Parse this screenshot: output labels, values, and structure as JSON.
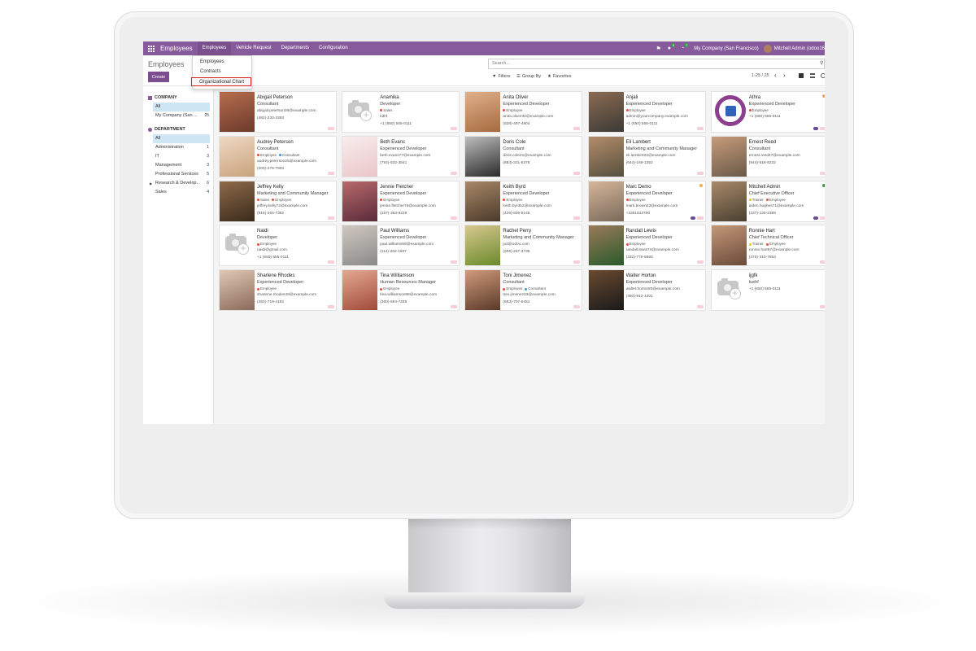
{
  "app": {
    "brand": "Employees",
    "menus": [
      "Employees",
      "Vehicle Request",
      "Departments",
      "Configuration"
    ],
    "company": "My Company (San Francisco)",
    "user": "Mitchell Admin (odoo16",
    "badges": {
      "messages": "5",
      "activities": "7"
    }
  },
  "dropdown": {
    "items": [
      "Employees",
      "Contracts",
      "Organizational Chart"
    ]
  },
  "control": {
    "breadcrumb": "Employees",
    "create": "Create",
    "search_placeholder": "Search...",
    "filters": "Filters",
    "group_by": "Group By",
    "favorites": "Favorites",
    "pager": "1-25 / 25"
  },
  "sidepanel": {
    "company_title": "COMPANY",
    "companies": [
      {
        "label": "All",
        "count": ""
      },
      {
        "label": "My Company (San ...",
        "count": "25"
      }
    ],
    "department_title": "DEPARTMENT",
    "departments": [
      {
        "label": "All",
        "count": ""
      },
      {
        "label": "Administration",
        "count": "1"
      },
      {
        "label": "IT",
        "count": "3"
      },
      {
        "label": "Management",
        "count": "3"
      },
      {
        "label": "Professional Services",
        "count": "5"
      },
      {
        "label": "Research & Develop...",
        "count": "6"
      },
      {
        "label": "Sales",
        "count": "4"
      }
    ]
  },
  "colors": {
    "primary": "#875a9b",
    "employee_tag": "#e74c3c",
    "consultant_tag": "#3498db",
    "trainer_tag": "#f1c40f"
  },
  "employees": [
    {
      "name": "Abigail Peterson",
      "job": "Consultant",
      "tags": [],
      "email": "abigail.peterson39@example.com",
      "phone": "(482)-233-3393",
      "photo": [
        "#6b3a2a",
        "#b66e4e"
      ]
    },
    {
      "name": "Anamika",
      "job": "Developer",
      "tags": [
        {
          "label": "Sales",
          "color": "#e74c3c"
        }
      ],
      "email": "kdhf",
      "phone": "+1 (650) 555-0111",
      "photo": "placeholder"
    },
    {
      "name": "Anita Oliver",
      "job": "Experienced Developer",
      "tags": [
        {
          "label": "Employee",
          "color": "#e74c3c"
        }
      ],
      "email": "anita.oliver32@example.com",
      "phone": "(538)-497-4804",
      "photo": [
        "#a56b3f",
        "#e0b08c"
      ]
    },
    {
      "name": "Anjali",
      "job": "Experienced Developer",
      "tags": [
        {
          "label": "Employee",
          "color": "#e74c3c"
        }
      ],
      "email": "admin@yourcompany.example.com",
      "phone": "+1 (650) 555-0111",
      "photo": [
        "#3c3a36",
        "#8b6b52"
      ]
    },
    {
      "name": "Athra",
      "job": "Experienced Developer",
      "tags": [
        {
          "label": "Employee",
          "color": "#e74c3c"
        }
      ],
      "email": "+1 (650) 555-0111",
      "phone": "",
      "photo": "logo",
      "status": "#f0ad4e",
      "chat": true
    },
    {
      "name": "Audrey Peterson",
      "job": "Consultant",
      "tags": [
        {
          "label": "Employee",
          "color": "#e74c3c"
        },
        {
          "label": "Consultant",
          "color": "#3498db"
        }
      ],
      "email": "audrey.peterson25@example.com",
      "phone": "(203)-276-7903",
      "photo": [
        "#c9a37d",
        "#eed8c2"
      ]
    },
    {
      "name": "Beth Evans",
      "job": "Experienced Developer",
      "tags": [],
      "email": "beth.evans77@example.com",
      "phone": "(754)-532-3841",
      "photo": [
        "#e9c6c9",
        "#f8eded"
      ]
    },
    {
      "name": "Doris Cole",
      "job": "Consultant",
      "tags": [],
      "email": "doris.cole31@example.com",
      "phone": "(883)-331-5378",
      "photo": [
        "#2b2b2b",
        "#bdbdbd"
      ]
    },
    {
      "name": "Eli Lambert",
      "job": "Marketing and Community Manager",
      "tags": [],
      "email": "eli.lambert22@example.com",
      "phone": "(644)-169-1352",
      "photo": [
        "#55503f",
        "#b38c6a"
      ]
    },
    {
      "name": "Ernest Reed",
      "job": "Consultant",
      "tags": [],
      "email": "ernest.reed47@example.com",
      "phone": "(944)-518-8232",
      "photo": [
        "#6a5a4a",
        "#c79b7a"
      ]
    },
    {
      "name": "Jeffrey Kelly",
      "job": "Marketing and Community Manager",
      "tags": [
        {
          "label": "Sales",
          "color": "#e74c3c"
        },
        {
          "label": "Employee",
          "color": "#e74c3c"
        }
      ],
      "email": "jeffrey.kelly72@example.com",
      "phone": "(916)-264-7362",
      "photo": [
        "#3a2a1a",
        "#8e6b4a"
      ]
    },
    {
      "name": "Jennie Fletcher",
      "job": "Experienced Developer",
      "tags": [
        {
          "label": "Employee",
          "color": "#e74c3c"
        }
      ],
      "email": "jennie.fletcher76@example.com",
      "phone": "(157)-363-8229",
      "photo": [
        "#5a2a3a",
        "#b86a6a"
      ]
    },
    {
      "name": "Keith Byrd",
      "job": "Experienced Developer",
      "tags": [
        {
          "label": "Employee",
          "color": "#e74c3c"
        }
      ],
      "email": "keith.byrd52@example.com",
      "phone": "(449)-505-5146",
      "photo": [
        "#4a3a2a",
        "#a88868"
      ]
    },
    {
      "name": "Marc Demo",
      "job": "Experienced Developer",
      "tags": [
        {
          "label": "Employee",
          "color": "#e74c3c"
        }
      ],
      "email": "mark.brown23@example.com",
      "phone": "+3281813700",
      "photo": [
        "#7a6a5a",
        "#d4b69a"
      ],
      "status": "#f0ad4e",
      "chat": true
    },
    {
      "name": "Mitchell Admin",
      "job": "Chief Executive Officer",
      "tags": [
        {
          "label": "Trainer",
          "color": "#f1c40f"
        },
        {
          "label": "Employee",
          "color": "#e74c3c"
        }
      ],
      "email": "aiden.hughes71@example.com",
      "phone": "(237)-125-2389",
      "photo": [
        "#4a4030",
        "#a88a6a"
      ],
      "status": "#28a745",
      "chat": true
    },
    {
      "name": "Naidi",
      "job": "Developer",
      "tags": [
        {
          "label": "Employee",
          "color": "#e74c3c"
        }
      ],
      "email": "naidi@gmail.com",
      "phone": "+1 (650) 555-0111",
      "photo": "placeholder"
    },
    {
      "name": "Paul Williams",
      "job": "Experienced Developer",
      "tags": [],
      "email": "paul.williams59@example.com",
      "phone": "(114)-262-1607",
      "photo": [
        "#8a8a8a",
        "#d0c8c0"
      ]
    },
    {
      "name": "Rachel Perry",
      "job": "Marketing and Community Manager",
      "tags": [],
      "email": "jod@odoo.com",
      "phone": "(206)-267-3735",
      "photo": [
        "#6a8a2a",
        "#d8c890"
      ]
    },
    {
      "name": "Randall Lewis",
      "job": "Experienced Developer",
      "tags": [
        {
          "label": "Employee",
          "color": "#e74c3c"
        }
      ],
      "email": "randall.lewis74@example.com",
      "phone": "(332)-775-6660",
      "photo": [
        "#2a5a2a",
        "#9a7a5a"
      ]
    },
    {
      "name": "Ronnie Hart",
      "job": "Chief Technical Officer",
      "tags": [
        {
          "label": "Trainer",
          "color": "#f1c40f"
        },
        {
          "label": "Employee",
          "color": "#e74c3c"
        }
      ],
      "email": "ronnie.hart87@example.com",
      "phone": "(376)-310-7863",
      "photo": [
        "#6a4a3a",
        "#c49878"
      ]
    },
    {
      "name": "Sharlene Rhodes",
      "job": "Experienced Developer",
      "tags": [
        {
          "label": "Employee",
          "color": "#e74c3c"
        }
      ],
      "email": "sharlene.rhodes49@example.com",
      "phone": "(450)-719-4182",
      "photo": [
        "#8a6a5a",
        "#e0c8b4"
      ]
    },
    {
      "name": "Tina Williamson",
      "job": "Human Resources Manager",
      "tags": [
        {
          "label": "Employee",
          "color": "#e74c3c"
        }
      ],
      "email": "tina.williamson98@example.com",
      "phone": "(360)-694-7266",
      "photo": [
        "#a04a3a",
        "#e4a890"
      ]
    },
    {
      "name": "Toni Jimenez",
      "job": "Consultant",
      "tags": [
        {
          "label": "Employee",
          "color": "#e74c3c"
        },
        {
          "label": "Consultant",
          "color": "#3498db"
        }
      ],
      "email": "toni.jimenez23@example.com",
      "phone": "(663)-707-8451",
      "photo": [
        "#5a3a2a",
        "#d09a7a"
      ]
    },
    {
      "name": "Walter Horton",
      "job": "Experienced Developer",
      "tags": [],
      "email": "walter.horton80@example.com",
      "phone": "(350)-912-1201",
      "photo": [
        "#1a1a1a",
        "#6a4a30"
      ]
    },
    {
      "name": "ijgfk",
      "job": "luehf",
      "tags": [],
      "email": "+1 (650) 555-0111",
      "phone": "",
      "photo": "placeholder"
    }
  ]
}
